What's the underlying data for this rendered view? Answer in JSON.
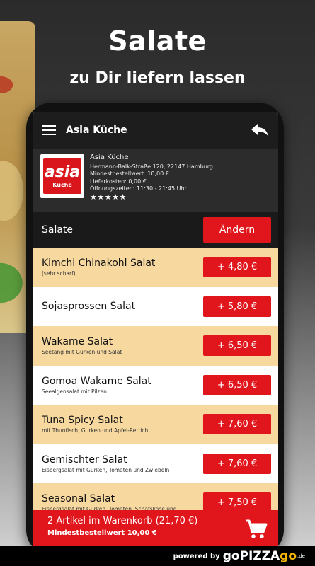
{
  "hero": {
    "title": "Salate",
    "subtitle": "zu Dir liefern lassen"
  },
  "appbar": {
    "title": "Asia Küche"
  },
  "shop": {
    "logo_main": "asia",
    "logo_sub": "Küche",
    "name": "Asia Küche",
    "address": "Hermann-Balk-Straße 120, 22147 Hamburg",
    "min_order": "Mindestbestellwert: 10,00 €",
    "delivery": "Lieferkosten: 0,00 €",
    "hours": "Öffnungszeiten: 11:30 - 21:45 Uhr",
    "rating": 5,
    "stars": "★★★★★"
  },
  "category": {
    "label": "Salate",
    "change_label": "Ändern"
  },
  "items": [
    {
      "name": "Kimchi Chinakohl Salat",
      "desc": "(sehr scharf)",
      "price": "+ 4,80 €"
    },
    {
      "name": "Sojasprossen Salat",
      "desc": "",
      "price": "+ 5,80 €"
    },
    {
      "name": "Wakame Salat",
      "desc": "Seetang mit Gurken und Salat",
      "price": "+ 6,50 €"
    },
    {
      "name": "Gomoa Wakame Salat",
      "desc": "Seealgensalat mit Pilzen",
      "price": "+ 6,50 €"
    },
    {
      "name": "Tuna Spicy Salat",
      "desc": "mit Thunfisch, Gurken und Apfel-Rettich",
      "price": "+ 7,60 €"
    },
    {
      "name": "Gemischter Salat",
      "desc": "Eisbergsalat mit Gurken, Tomaten und Zwiebeln",
      "price": "+ 7,60 €"
    },
    {
      "name": "Seasonal Salat",
      "desc": "Eisbergsalat mit Gurken, Tomaten, Schafskäse und",
      "price": "+ 7,50 €"
    }
  ],
  "cart": {
    "summary": "2 Artikel im Warenkorb (21,70 €)",
    "min_order": "Mindestbestellwert 10,00 €"
  },
  "footer": {
    "prefix": "powered by",
    "brand_go": "go",
    "brand_pizza": "PIZZA",
    "brand_go2": "go",
    "tld": ".de"
  },
  "colors": {
    "accent": "#e0161c",
    "row_alt": "#f7d9a0",
    "appbar": "#1d1d1d"
  }
}
